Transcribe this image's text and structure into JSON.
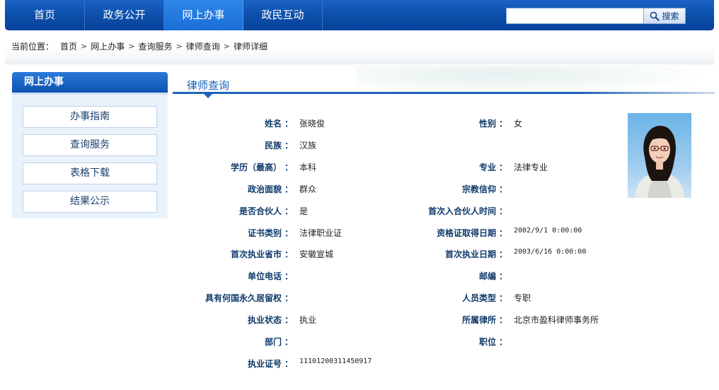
{
  "nav": {
    "items": [
      {
        "label": "首页"
      },
      {
        "label": "政务公开"
      },
      {
        "label": "网上办事"
      },
      {
        "label": "政民互动"
      }
    ],
    "active_index": 2,
    "search": {
      "value": "",
      "button_label": "搜索"
    }
  },
  "breadcrumb": {
    "prefix": "当前位置：",
    "items": [
      "首页",
      "网上办事",
      "查询服务",
      "律师查询",
      "律师详细"
    ]
  },
  "sidebar": {
    "title": "网上办事",
    "items": [
      {
        "label": "办事指南"
      },
      {
        "label": "查询服务"
      },
      {
        "label": "表格下载"
      },
      {
        "label": "结果公示"
      }
    ]
  },
  "main": {
    "title": "律师查询",
    "colon": "：",
    "rows": [
      {
        "left_label": "姓名",
        "left_value": "张晓俊",
        "right_label": "性别",
        "right_value": "女"
      },
      {
        "left_label": "民族",
        "left_value": "汉族",
        "right_label": "",
        "right_value": ""
      },
      {
        "left_label": "学历（最高）",
        "left_value": "本科",
        "right_label": "专业",
        "right_value": "法律专业"
      },
      {
        "left_label": "政治面貌",
        "left_value": "群众",
        "right_label": "宗教信仰",
        "right_value": ""
      },
      {
        "left_label": "是否合伙人",
        "left_value": "是",
        "right_label": "首次入合伙人时间",
        "right_value": ""
      },
      {
        "left_label": "证书类别",
        "left_value": "法律职业证",
        "right_label": "资格证取得日期",
        "right_value": "2002/9/1 0:00:00"
      },
      {
        "left_label": "首次执业省市",
        "left_value": "安徽宣城",
        "right_label": "首次执业日期",
        "right_value": "2003/6/16 0:00:00"
      },
      {
        "left_label": "单位电话",
        "left_value": "",
        "right_label": "邮编",
        "right_value": ""
      },
      {
        "left_label": "具有何国永久居留权",
        "left_value": "",
        "right_label": "人员类型",
        "right_value": "专职"
      },
      {
        "left_label": "执业状态",
        "left_value": "执业",
        "right_label": "所属律所",
        "right_value": "北京市盈科律师事务所"
      },
      {
        "left_label": "部门",
        "left_value": "",
        "right_label": "职位",
        "right_value": ""
      },
      {
        "left_label": "执业证号",
        "left_value": "11101200311450917",
        "right_label": "",
        "right_value": ""
      }
    ]
  },
  "colors": {
    "nav_bg": "#0c4ea9",
    "nav_active": "#1a6fd8",
    "label_text": "#0f3a6a",
    "title_blue": "#1860b8",
    "sidebar_bg": "#e9f2fb"
  },
  "icons": {
    "search": "magnifier-icon"
  }
}
